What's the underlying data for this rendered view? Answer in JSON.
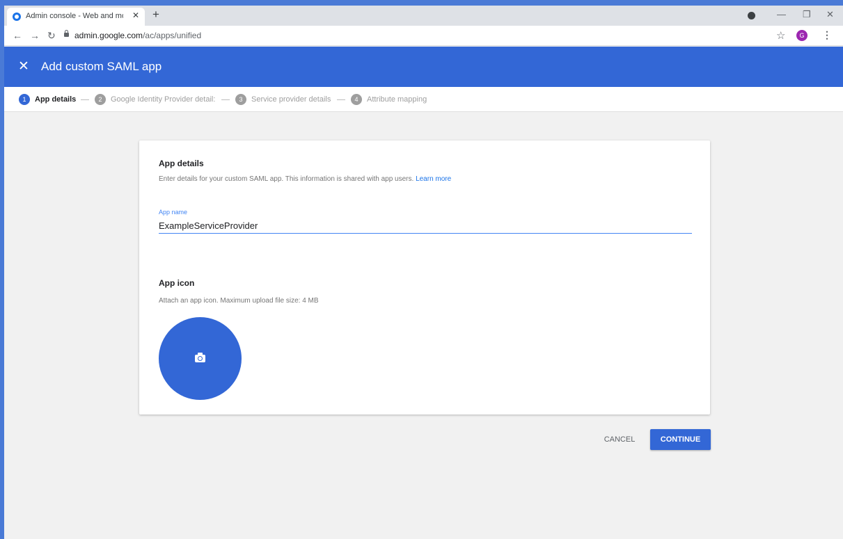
{
  "browser": {
    "tab_title": "Admin console - Web and mobile apps",
    "tab_close": "✕",
    "new_tab": "+",
    "url_host": "admin.google.com",
    "url_path": "/ac/apps/unified",
    "profile_initial": "G"
  },
  "header": {
    "close": "✕",
    "title": "Add custom SAML app"
  },
  "stepper": {
    "steps": [
      {
        "number": "1",
        "label": "App details",
        "active": true
      },
      {
        "number": "2",
        "label": "Google Identity Provider detail:",
        "active": false
      },
      {
        "number": "3",
        "label": "Service provider details",
        "active": false
      },
      {
        "number": "4",
        "label": "Attribute mapping",
        "active": false
      }
    ]
  },
  "card": {
    "app_details_heading": "App details",
    "app_details_desc": "Enter details for your custom SAML app. This information is shared with app users.",
    "learn_more": "Learn more",
    "app_name_label": "App name",
    "app_name_value": "ExampleServiceProvider",
    "app_icon_heading": "App icon",
    "app_icon_desc": "Attach an app icon. Maximum upload file size: 4 MB"
  },
  "actions": {
    "cancel": "CANCEL",
    "continue": "CONTINUE"
  },
  "colors": {
    "primary": "#3367d6",
    "link": "#1a73e8",
    "background": "#f1f1f1"
  }
}
